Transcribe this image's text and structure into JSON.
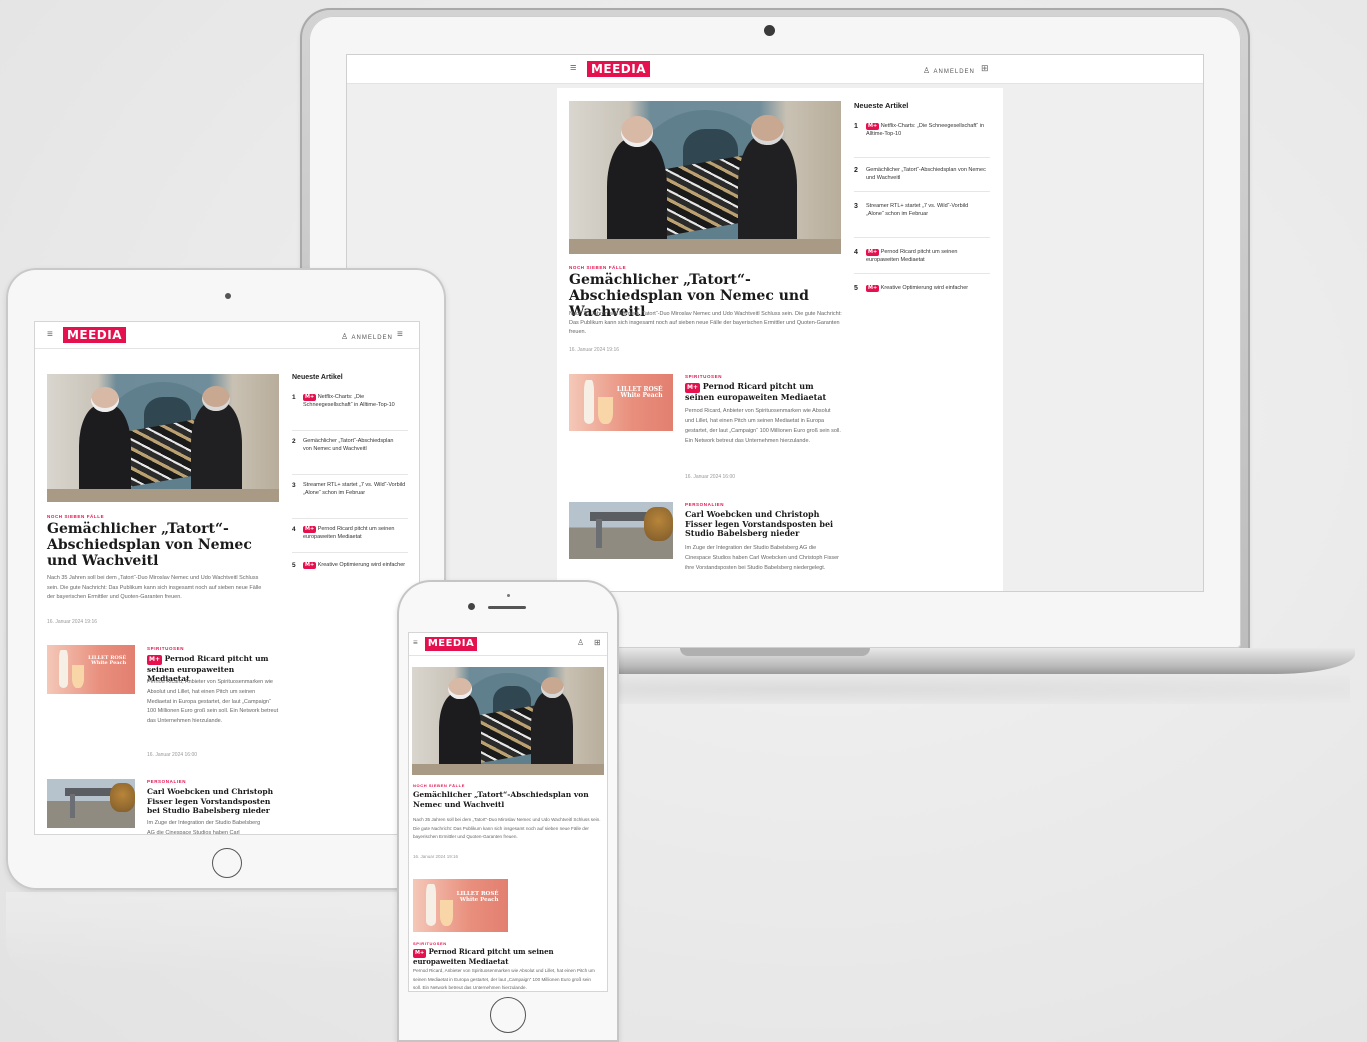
{
  "site": {
    "logo": "MEEDIA",
    "login_label": "ANMELDEN",
    "hamburger_glyph": "≡",
    "user_glyph": "♙",
    "grid_glyph": "⊞",
    "brand_color": "#e4114e"
  },
  "hero": {
    "kicker": "NOCH SIEBEN FÄLLE",
    "title": "Gemächlicher „Tatort“-Abschiedsplan von Nemec und Wachveitl",
    "teaser": "Nach 35 Jahren soll bei dem „Tatort“-Duo Miroslav Nemec und Udo Wachtveitl Schluss sein. Die gute Nachricht: Das Publikum kann sich insgesamt noch auf sieben neue Fälle der bayerischen Ermittler und Quoten-Garanten freuen.",
    "date": "16. Januar 2024 19:16"
  },
  "articles": [
    {
      "kicker": "SPIRITUOSEN",
      "badge": "M+",
      "title": "Pernod Ricard pitcht um seinen europaweiten Mediaetat",
      "teaser": "Pernod Ricard, Anbieter von Spirituosenmarken wie Absolut und Lillet, hat einen Pitch um seinen Mediaetat in Europa gestartet, der laut „Campaign“ 100 Millionen Euro groß sein soll. Ein Network betreut das Unternehmen hierzulande.",
      "date": "16. Januar 2024 16:00",
      "thumb_text_1": "LILLET ROSÉ",
      "thumb_text_2": "White Peach"
    },
    {
      "kicker": "PERSONALIEN",
      "title": "Carl Woebcken und Christoph Fisser legen Vorstandsposten bei Studio Babelsberg nieder",
      "teaser": "Im Zuge der Integration der Studio Babelsberg AG die Cinespace Studios haben Carl Woebcken und Christoph Fisser ihre Vorstandsposten bei Studio Babelsberg niedergelegt."
    }
  ],
  "sidebar": {
    "title": "Neueste Artikel",
    "items": [
      {
        "rank": "1",
        "badge": "M+",
        "text": "Netflix-Charts: „Die Schneegesellschaft“ in Alltime-Top-10"
      },
      {
        "rank": "2",
        "badge": "",
        "text": "Gemächlicher „Tatort“-Abschiedsplan von Nemec und Wachveitl"
      },
      {
        "rank": "3",
        "badge": "",
        "text": "Streamer RTL+ startet „7 vs. Wild“-Vorbild „Alone“ schon im Februar"
      },
      {
        "rank": "4",
        "badge": "M+",
        "text": "Pernod Ricard pitcht um seinen europaweiten Mediaetat"
      },
      {
        "rank": "5",
        "badge": "M+",
        "text": "Kreative Optimierung wird einfacher"
      }
    ]
  }
}
